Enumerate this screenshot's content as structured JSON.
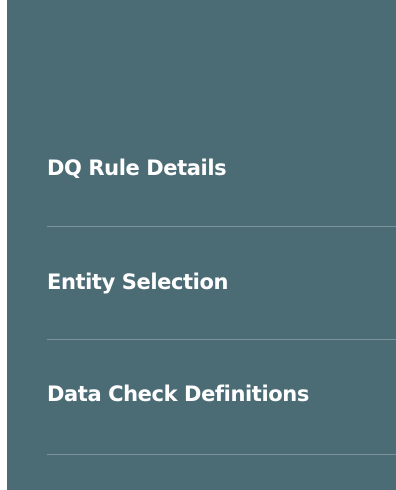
{
  "navigation": {
    "items": [
      {
        "label": "DQ Rule Details"
      },
      {
        "label": "Entity Selection"
      },
      {
        "label": "Data Check Definitions"
      }
    ]
  },
  "colors": {
    "panel_background": "#4b6b75",
    "text": "#ffffff",
    "divider": "#7b939a"
  }
}
